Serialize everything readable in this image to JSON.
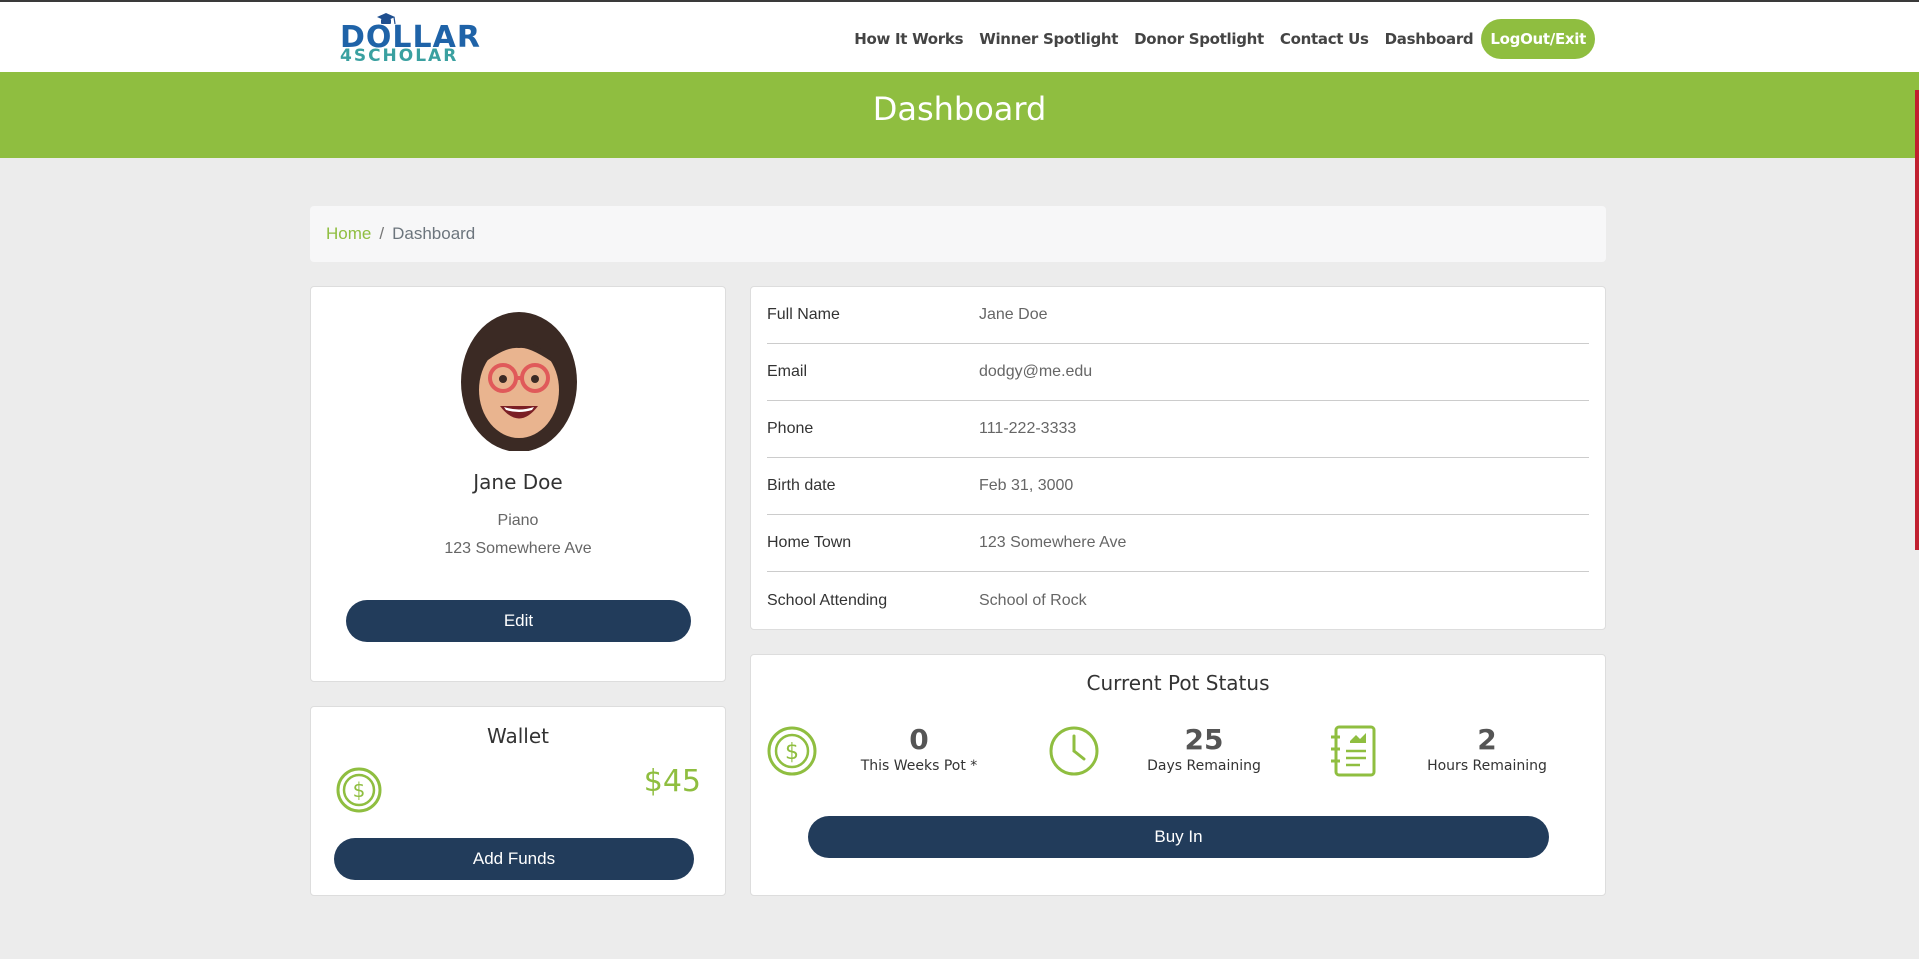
{
  "brand": {
    "logo_line1": "DOLLAR",
    "logo_line2": "4SCHOLAR",
    "primary_color": "#8fbe40",
    "dark_color": "#223c5b"
  },
  "nav": {
    "items": [
      "How It Works",
      "Winner Spotlight",
      "Donor Spotlight",
      "Contact Us",
      "Dashboard"
    ],
    "logout": "LogOut/Exit"
  },
  "header": {
    "title": "Dashboard"
  },
  "breadcrumb": {
    "home": "Home",
    "separator": "/",
    "current": "Dashboard"
  },
  "profile": {
    "name": "Jane Doe",
    "instrument": "Piano",
    "address": "123 Somewhere Ave",
    "edit_label": "Edit"
  },
  "info": {
    "rows": [
      {
        "label": "Full Name",
        "value": "Jane Doe"
      },
      {
        "label": "Email",
        "value": "dodgy@me.edu"
      },
      {
        "label": "Phone",
        "value": "111-222-3333"
      },
      {
        "label": "Birth date",
        "value": "Feb 31, 3000"
      },
      {
        "label": "Home Town",
        "value": "123 Somewhere Ave"
      },
      {
        "label": "School Attending",
        "value": "School of Rock"
      }
    ]
  },
  "wallet": {
    "title": "Wallet",
    "amount": "$45",
    "add_funds_label": "Add Funds",
    "icon": "dollar-coin-icon"
  },
  "pot": {
    "title": "Current Pot Status",
    "stats": [
      {
        "value": "0",
        "label": "This Weeks Pot *",
        "icon": "dollar-coin-icon"
      },
      {
        "value": "25",
        "label": "Days Remaining",
        "icon": "clock-icon"
      },
      {
        "value": "2",
        "label": "Hours Remaining",
        "icon": "notebook-icon"
      }
    ],
    "buy_in_label": "Buy In"
  }
}
